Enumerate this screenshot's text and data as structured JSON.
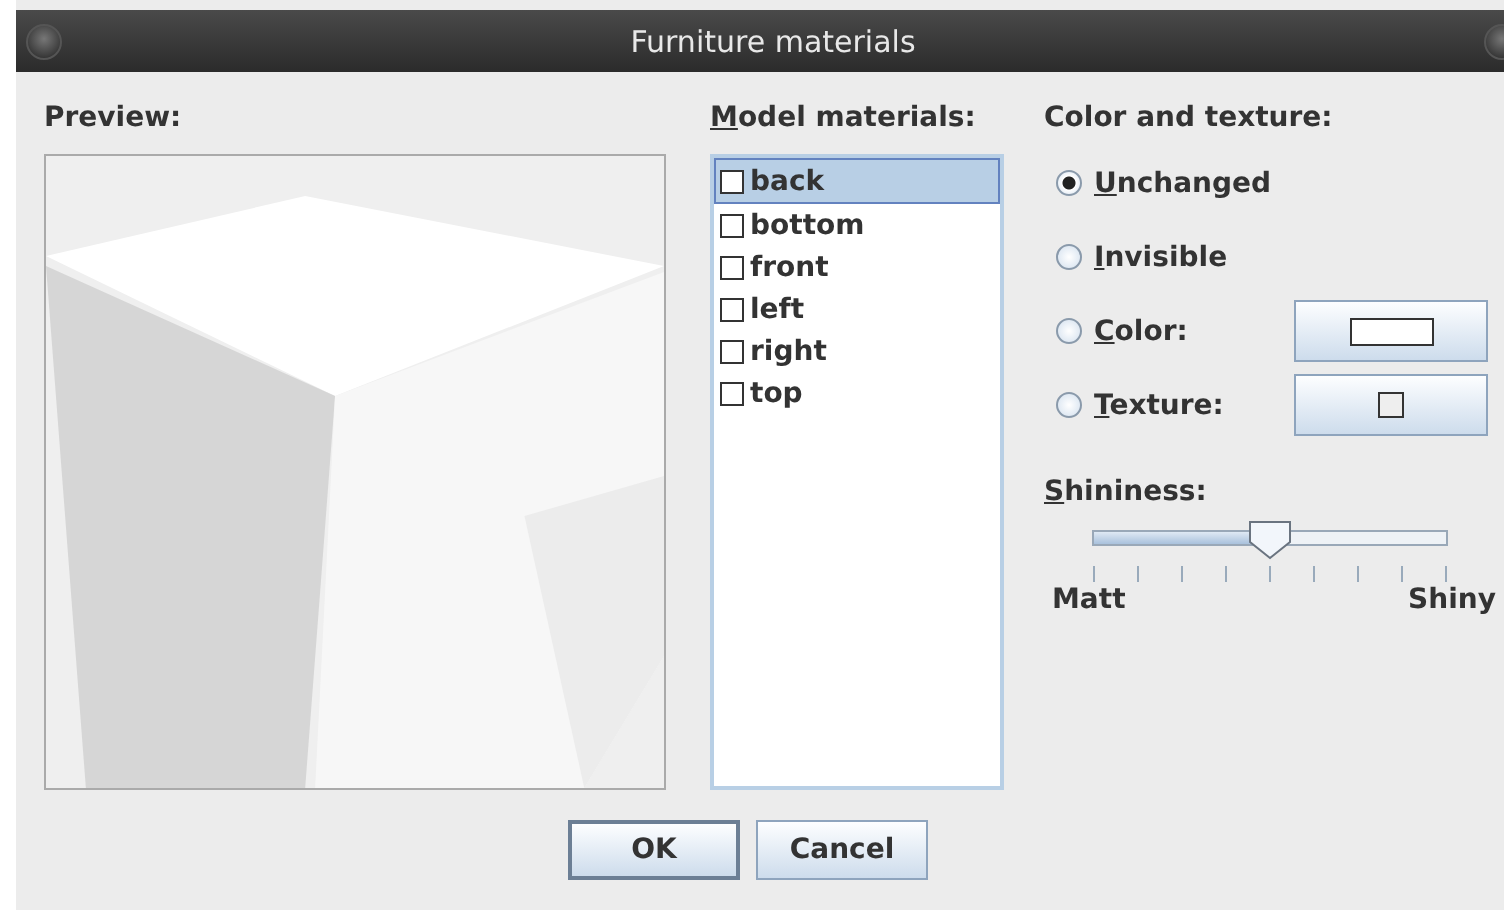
{
  "window": {
    "title": "Furniture materials"
  },
  "preview": {
    "label": "Preview:",
    "kind": "picture"
  },
  "materials": {
    "label": "Model materials:",
    "items": [
      {
        "name": "back",
        "checked": false,
        "selected": true
      },
      {
        "name": "bottom",
        "checked": false,
        "selected": false
      },
      {
        "name": "front",
        "checked": false,
        "selected": false
      },
      {
        "name": "left",
        "checked": false,
        "selected": false
      },
      {
        "name": "right",
        "checked": false,
        "selected": false
      },
      {
        "name": "top",
        "checked": false,
        "selected": false
      }
    ]
  },
  "color_and_texture": {
    "label": "Color and texture:",
    "options": [
      {
        "label": "Unchanged",
        "selected": true,
        "kind": "plain"
      },
      {
        "label": "Invisible",
        "selected": false,
        "kind": "plain"
      },
      {
        "label": "Color:",
        "selected": false,
        "kind": "color"
      },
      {
        "label": "Texture:",
        "selected": false,
        "kind": "texture"
      }
    ]
  },
  "shininess": {
    "label": "Shininess:",
    "level": 0.5,
    "min_label": "Matt",
    "max_label": "Shiny"
  },
  "buttons": [
    {
      "label": "OK",
      "default": true
    },
    {
      "label": "Cancel",
      "default": false
    }
  ]
}
